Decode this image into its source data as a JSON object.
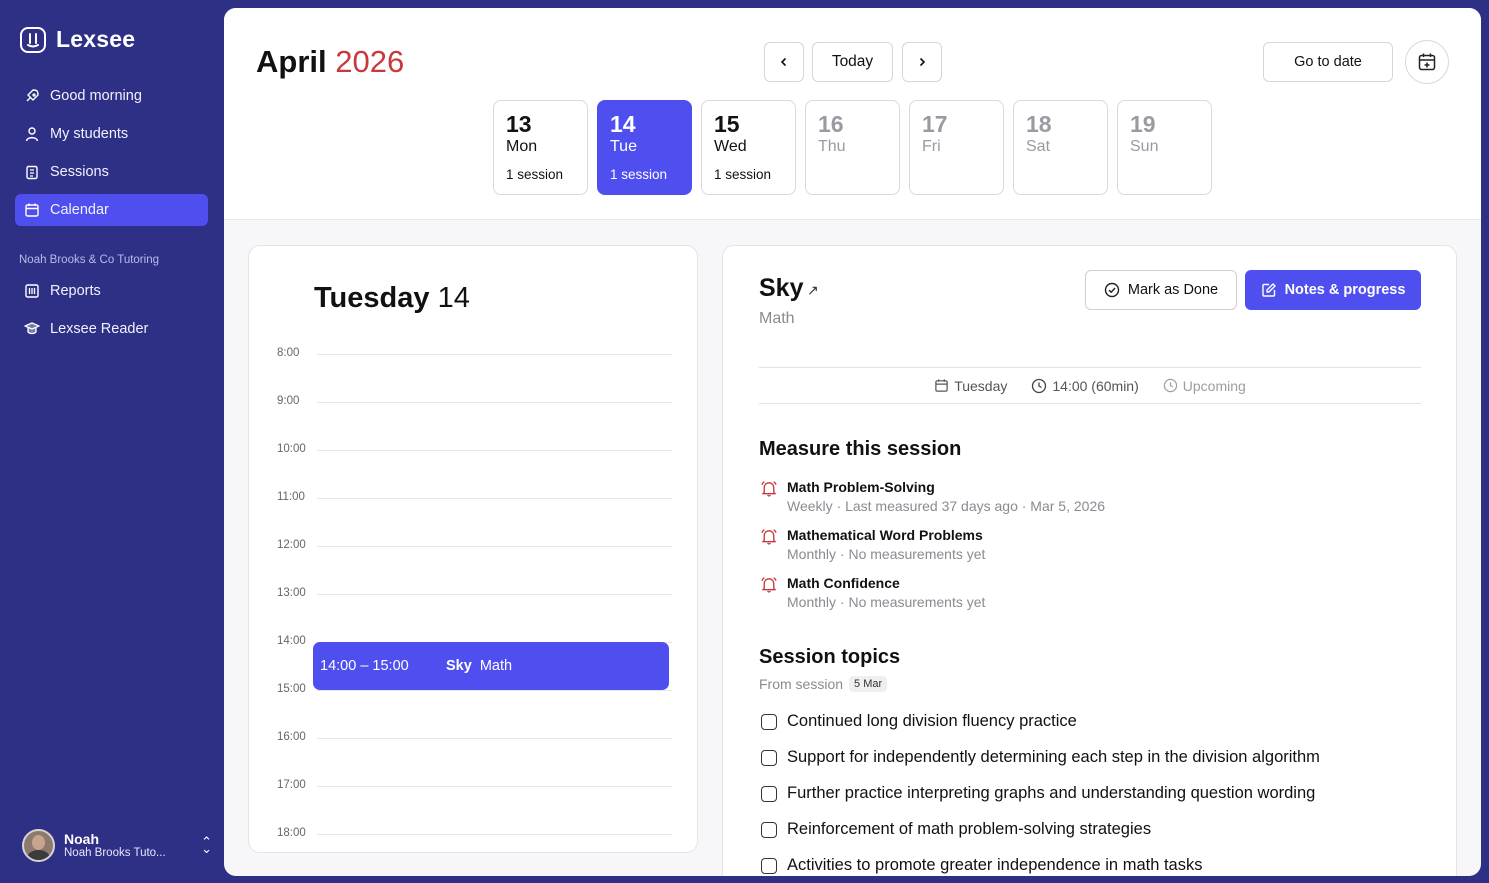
{
  "app": {
    "name": "Lexsee"
  },
  "sidebar": {
    "items": [
      {
        "label": "Good morning",
        "icon": "rocket-icon"
      },
      {
        "label": "My students",
        "icon": "user-icon"
      },
      {
        "label": "Sessions",
        "icon": "clipboard-icon"
      },
      {
        "label": "Calendar",
        "icon": "calendar-icon",
        "active": true
      }
    ],
    "org_label": "Noah Brooks & Co Tutoring",
    "org_items": [
      {
        "label": "Reports",
        "icon": "reports-icon"
      },
      {
        "label": "Lexsee Reader",
        "icon": "reader-icon"
      }
    ],
    "user": {
      "name": "Noah",
      "org": "Noah Brooks Tuto..."
    }
  },
  "header": {
    "month": "April",
    "year": "2026",
    "today_label": "Today",
    "go_to_date_label": "Go to date"
  },
  "week": [
    {
      "num": "13",
      "day": "Mon",
      "sessions": "1 session"
    },
    {
      "num": "14",
      "day": "Tue",
      "sessions": "1 session",
      "active": true
    },
    {
      "num": "15",
      "day": "Wed",
      "sessions": "1 session"
    },
    {
      "num": "16",
      "day": "Thu",
      "sessions": ""
    },
    {
      "num": "17",
      "day": "Fri",
      "sessions": ""
    },
    {
      "num": "18",
      "day": "Sat",
      "sessions": ""
    },
    {
      "num": "19",
      "day": "Sun",
      "sessions": ""
    }
  ],
  "day_view": {
    "weekday": "Tuesday",
    "date": "14",
    "hours": [
      "8:00",
      "9:00",
      "10:00",
      "11:00",
      "12:00",
      "13:00",
      "14:00",
      "15:00",
      "16:00",
      "17:00",
      "18:00"
    ],
    "event": {
      "time": "14:00 – 15:00",
      "student": "Sky",
      "subject": "Math"
    }
  },
  "session": {
    "student": "Sky",
    "subject": "Math",
    "mark_done_label": "Mark as Done",
    "notes_label": "Notes & progress",
    "day": "Tuesday",
    "time": "14:00 (60min)",
    "status": "Upcoming",
    "measure_title": "Measure this session",
    "measures": [
      {
        "title": "Math Problem-Solving",
        "sub": "Weekly · Last measured 37 days ago · Mar 5, 2026"
      },
      {
        "title": "Mathematical Word Problems",
        "sub": "Monthly · No measurements yet"
      },
      {
        "title": "Math Confidence",
        "sub": "Monthly · No measurements yet"
      }
    ],
    "topics_title": "Session topics",
    "from_session_label": "From session",
    "from_session_date": "5 Mar",
    "topics": [
      "Continued long division fluency practice",
      "Support for independently determining each step in the division algorithm",
      "Further practice interpreting graphs and understanding question wording",
      "Reinforcement of math problem-solving strategies",
      "Activities to promote greater independence in math tasks"
    ]
  },
  "colors": {
    "sidebar": "#2e3086",
    "accent": "#4f4ff0",
    "year": "#c8383c",
    "bell": "#c8383c"
  }
}
